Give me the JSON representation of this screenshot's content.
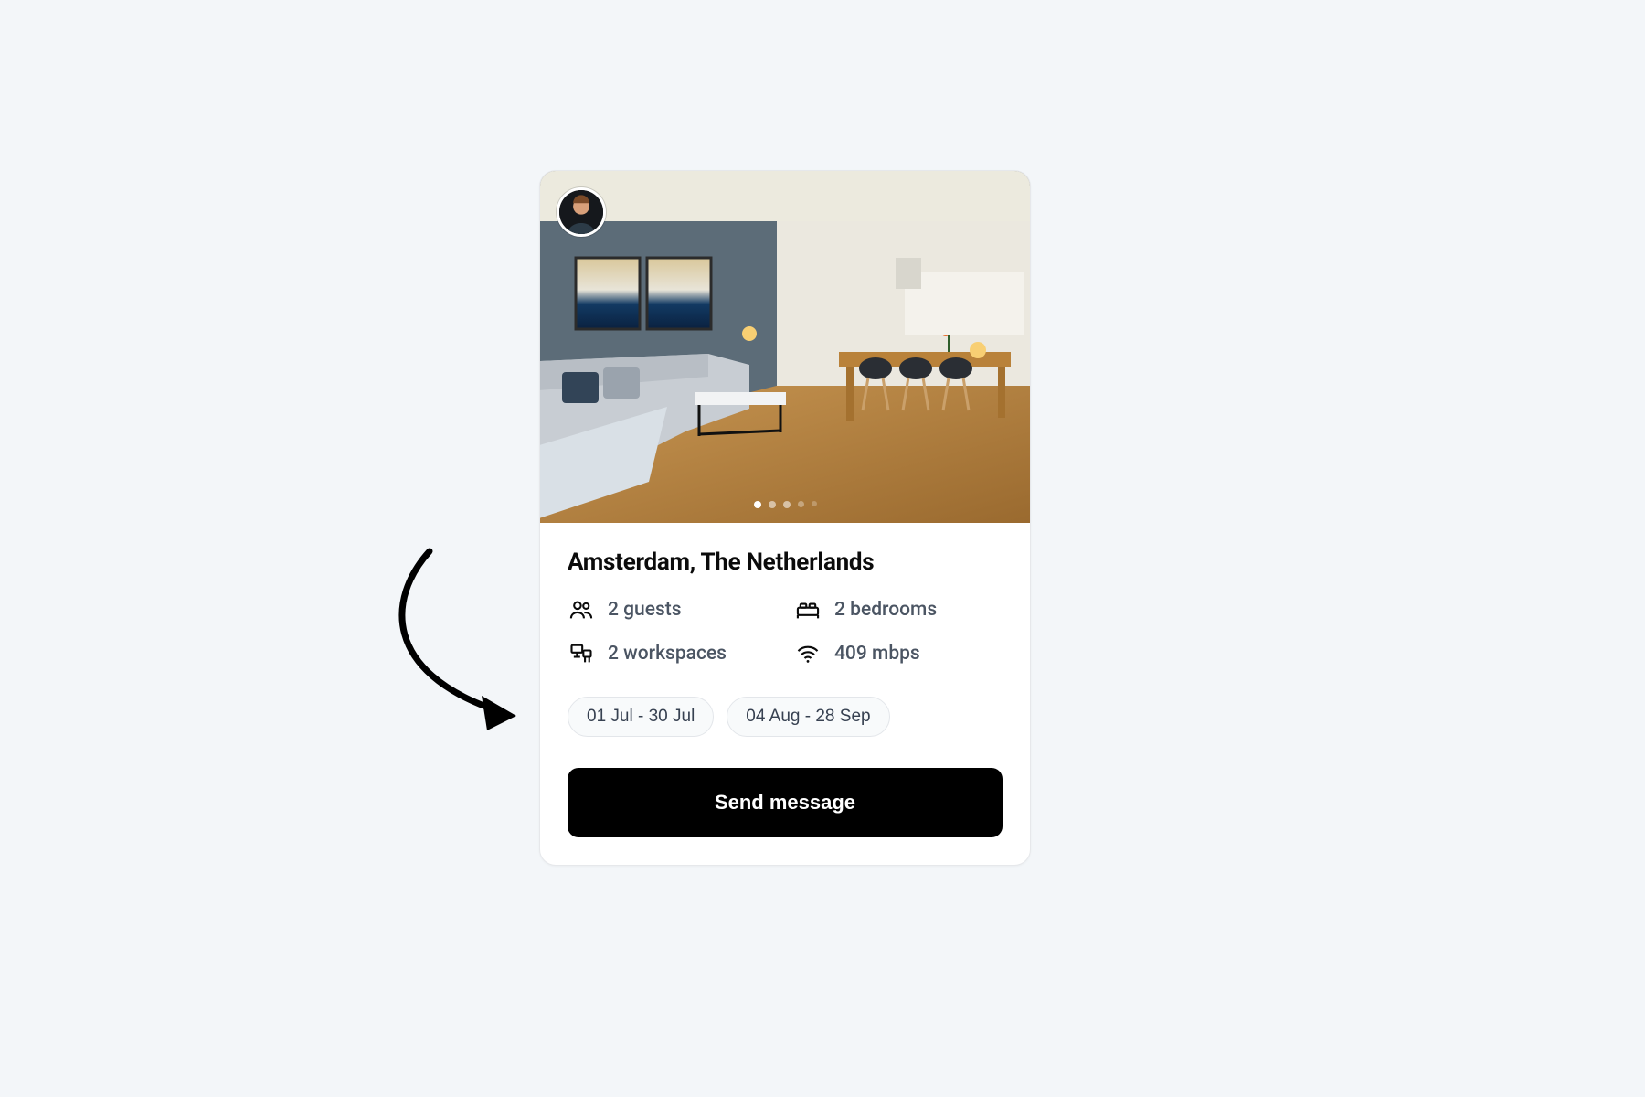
{
  "listing": {
    "title": "Amsterdam, The Netherlands",
    "features": {
      "guests": "2 guests",
      "bedrooms": "2 bedrooms",
      "workspaces": "2 workspaces",
      "internet": "409 mbps"
    },
    "availability": [
      "01 Jul - 30 Jul",
      "04 Aug - 28 Sep"
    ],
    "cta_label": "Send message",
    "carousel": {
      "count": 5,
      "active_index": 0
    }
  }
}
